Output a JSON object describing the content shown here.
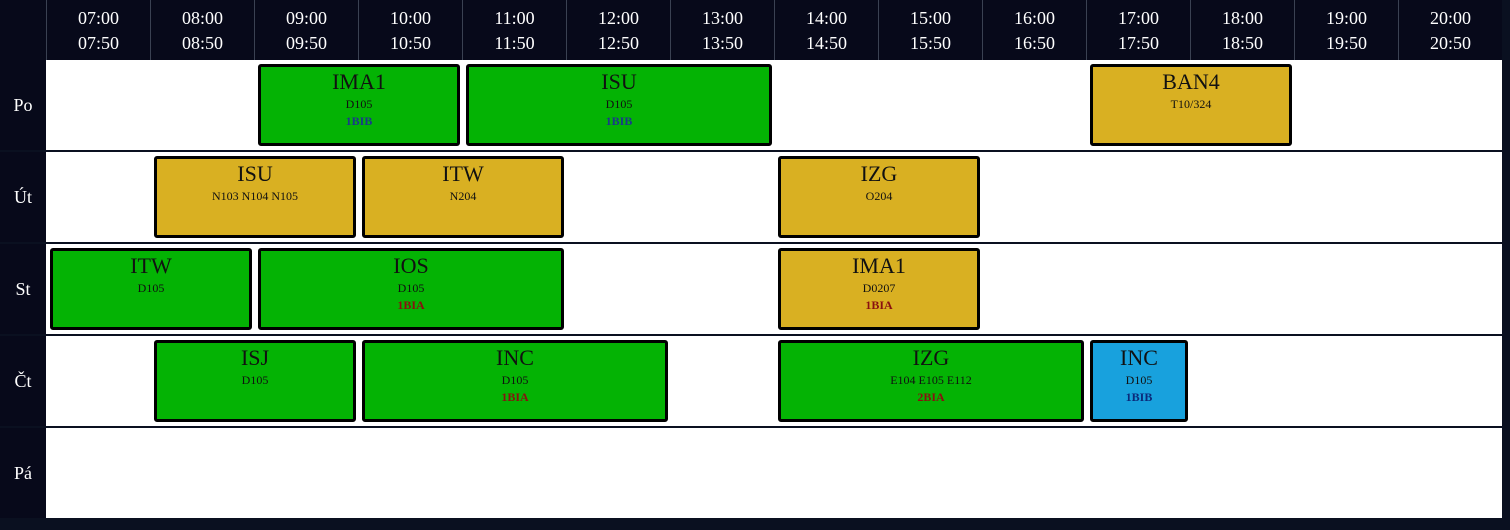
{
  "timetable": {
    "hours": [
      {
        "start": "07:00",
        "end": "07:50"
      },
      {
        "start": "08:00",
        "end": "08:50"
      },
      {
        "start": "09:00",
        "end": "09:50"
      },
      {
        "start": "10:00",
        "end": "10:50"
      },
      {
        "start": "11:00",
        "end": "11:50"
      },
      {
        "start": "12:00",
        "end": "12:50"
      },
      {
        "start": "13:00",
        "end": "13:50"
      },
      {
        "start": "14:00",
        "end": "14:50"
      },
      {
        "start": "15:00",
        "end": "15:50"
      },
      {
        "start": "16:00",
        "end": "16:50"
      },
      {
        "start": "17:00",
        "end": "17:50"
      },
      {
        "start": "18:00",
        "end": "18:50"
      },
      {
        "start": "19:00",
        "end": "19:50"
      },
      {
        "start": "20:00",
        "end": "20:50"
      }
    ],
    "days": [
      "Po",
      "Út",
      "St",
      "Čt",
      "Pá"
    ],
    "colors": {
      "green": "#04b304",
      "gold": "#d9b022",
      "blue": "#18a1dd",
      "header_bg": "#07091a"
    },
    "entries": [
      {
        "day": 0,
        "start_hour": "09:00",
        "end_hour": "10:50",
        "subject": "IMA1",
        "room": "D105",
        "group": "1BIB",
        "color": "green",
        "group_color": "blue"
      },
      {
        "day": 0,
        "start_hour": "11:00",
        "end_hour": "13:50",
        "subject": "ISU",
        "room": "D105",
        "group": "1BIB",
        "color": "green",
        "group_color": "blue"
      },
      {
        "day": 0,
        "start_hour": "17:00",
        "end_hour": "18:50",
        "subject": "BAN4",
        "room": "T10/324",
        "group": "",
        "color": "gold",
        "group_color": ""
      },
      {
        "day": 1,
        "start_hour": "08:00",
        "end_hour": "09:50",
        "subject": "ISU",
        "room": "N103 N104 N105",
        "group": "",
        "color": "gold",
        "group_color": ""
      },
      {
        "day": 1,
        "start_hour": "10:00",
        "end_hour": "11:50",
        "subject": "ITW",
        "room": "N204",
        "group": "",
        "color": "gold",
        "group_color": ""
      },
      {
        "day": 1,
        "start_hour": "14:00",
        "end_hour": "15:50",
        "subject": "IZG",
        "room": "O204",
        "group": "",
        "color": "gold",
        "group_color": ""
      },
      {
        "day": 2,
        "start_hour": "07:00",
        "end_hour": "08:50",
        "subject": "ITW",
        "room": "D105",
        "group": "",
        "color": "green",
        "group_color": ""
      },
      {
        "day": 2,
        "start_hour": "09:00",
        "end_hour": "11:50",
        "subject": "IOS",
        "room": "D105",
        "group": "1BIA",
        "color": "green",
        "group_color": "red"
      },
      {
        "day": 2,
        "start_hour": "14:00",
        "end_hour": "15:50",
        "subject": "IMA1",
        "room": "D0207",
        "group": "1BIA",
        "color": "gold",
        "group_color": "red"
      },
      {
        "day": 3,
        "start_hour": "08:00",
        "end_hour": "09:50",
        "subject": "ISJ",
        "room": "D105",
        "group": "",
        "color": "green",
        "group_color": ""
      },
      {
        "day": 3,
        "start_hour": "10:00",
        "end_hour": "12:50",
        "subject": "INC",
        "room": "D105",
        "group": "1BIA",
        "color": "green",
        "group_color": "red"
      },
      {
        "day": 3,
        "start_hour": "14:00",
        "end_hour": "16:50",
        "subject": "IZG",
        "room": "E104 E105 E112",
        "group": "2BIA",
        "color": "green",
        "group_color": "red"
      },
      {
        "day": 3,
        "start_hour": "17:00",
        "end_hour": "17:50",
        "subject": "INC",
        "room": "D105",
        "group": "1BIB",
        "color": "blue",
        "group_color": "navy"
      }
    ]
  }
}
